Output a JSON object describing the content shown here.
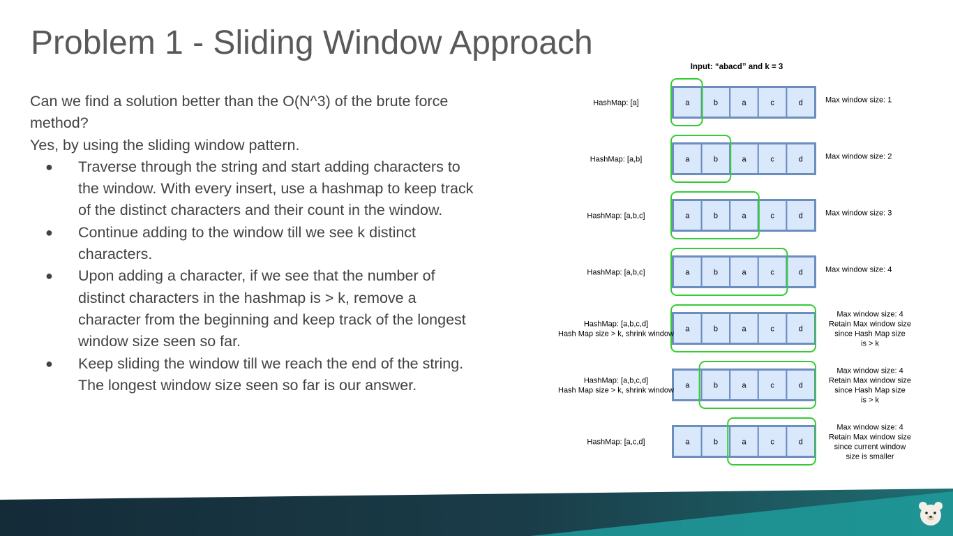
{
  "title": "Problem 1 - Sliding Window Approach",
  "intro": [
    "Can we find a solution better than the O(N^3) of the brute force method?",
    "Yes, by using the sliding window pattern."
  ],
  "bullets": [
    "Traverse through the string and start adding characters to the window. With every insert, use a hashmap to keep track of the distinct characters and their count in the window.",
    "Continue adding to the window till we see k distinct characters.",
    "Upon adding a character, if we see that the number of distinct characters in the hashmap is > k, remove a character from the beginning and keep track of the longest window size seen so far.",
    "Keep sliding the window till we reach the end of the string. The longest window size seen so far is our answer."
  ],
  "bullet_glyph": "●",
  "diagram": {
    "input_label": "Input: “abacd” and k = 3",
    "chars": [
      "a",
      "b",
      "a",
      "c",
      "d"
    ],
    "rows": [
      {
        "hashmap": [
          "HashMap: [a]"
        ],
        "note": [
          "Max window size: 1"
        ],
        "window_start": 0,
        "window_end": 0
      },
      {
        "hashmap": [
          "HashMap: [a,b]"
        ],
        "note": [
          "Max window size: 2"
        ],
        "window_start": 0,
        "window_end": 1
      },
      {
        "hashmap": [
          "HashMap: [a,b,c]"
        ],
        "note": [
          "Max window size: 3"
        ],
        "window_start": 0,
        "window_end": 2
      },
      {
        "hashmap": [
          "HashMap: [a,b,c]"
        ],
        "note": [
          "Max window size: 4"
        ],
        "window_start": 0,
        "window_end": 3
      },
      {
        "hashmap": [
          "HashMap: [a,b,c,d]",
          "Hash Map size > k, shrink window"
        ],
        "note": [
          "Max window size: 4",
          "Retain Max window size",
          "since Hash Map size",
          "is > k"
        ],
        "window_start": 0,
        "window_end": 4
      },
      {
        "hashmap": [
          "HashMap: [a,b,c,d]",
          "Hash Map size > k, shrink window"
        ],
        "note": [
          "Max window size: 4",
          "Retain Max window size",
          "since Hash Map size",
          "is > k"
        ],
        "window_start": 1,
        "window_end": 4
      },
      {
        "hashmap": [
          "HashMap: [a,c,d]"
        ],
        "note": [
          "Max window size: 4",
          "Retain Max window size",
          "since current window",
          "size is smaller"
        ],
        "window_start": 2,
        "window_end": 4
      }
    ],
    "colors": {
      "cell_fill": "#dae8fc",
      "cell_border": "#6c8ebf",
      "window": "#33cc33",
      "text": "#000000"
    }
  },
  "logo": "bear-mascot-icon",
  "colors": {
    "title": "#595959",
    "body": "#424242",
    "footer_dark": "#17323f",
    "footer_teal": "#1f9b9b"
  }
}
